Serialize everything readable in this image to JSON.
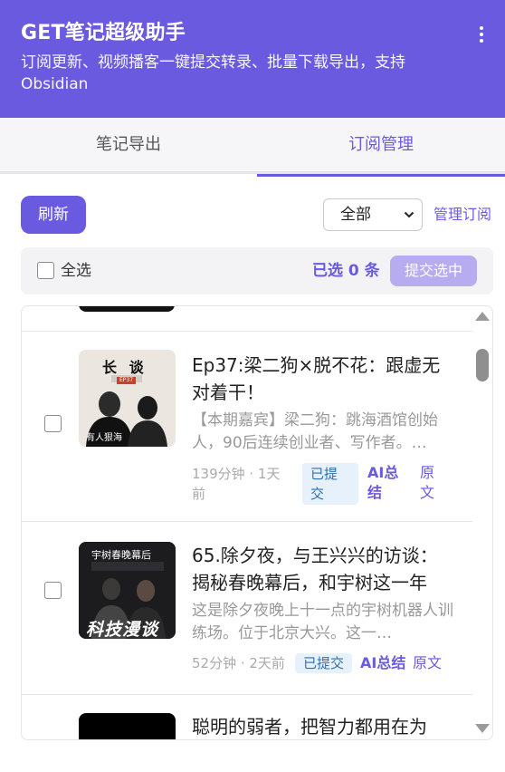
{
  "header": {
    "title": "GET笔记超级助手",
    "subtitle": "订阅更新、视频播客一键提交转录、批量下载导出，支持 Obsidian",
    "more_icon": "more-vertical-icon"
  },
  "tabs": [
    {
      "label": "笔记导出",
      "active": false
    },
    {
      "label": "订阅管理",
      "active": true
    }
  ],
  "toolbar": {
    "refresh_label": "刷新",
    "filter_value": "全部",
    "manage_label": "管理订阅"
  },
  "selection": {
    "select_all_label": "全选",
    "selected_count_label": "已选 0 条",
    "submit_label": "提交选中"
  },
  "episodes": [
    {
      "title": "Ep37:梁二狗×脱不花：跟虚无对着干！",
      "description": "【本期嘉宾】梁二狗：跳海酒馆创始人，90后连续创业者、写作者。…",
      "meta": "139分钟 · 1天前",
      "status": "已提交",
      "ai_label": "AI总结",
      "source_label": "原文",
      "thumb_text_top": "长 谈",
      "thumb_text_bottom": "有人狠海",
      "thumb_text_badge": "EP37"
    },
    {
      "title": "65.除夕夜，与王兴兴的访谈：揭秘春晚幕后，和宇树这一年",
      "description": "这是除夕夜晚上十一点的宇树机器人训练场。位于北京大兴。这一…",
      "meta": "52分钟 · 2天前",
      "status": "已提交",
      "ai_label": "AI总结",
      "source_label": "原文",
      "thumb_text_top": "宇树春晚幕后",
      "thumb_text_bottom": "科技漫谈"
    },
    {
      "title": "聪明的弱者，把智力都用在为"
    }
  ],
  "colors": {
    "brand": "#6a5ae0",
    "submitted_badge_bg": "#e7f1fb",
    "submitted_badge_text": "#2f6fb0"
  }
}
